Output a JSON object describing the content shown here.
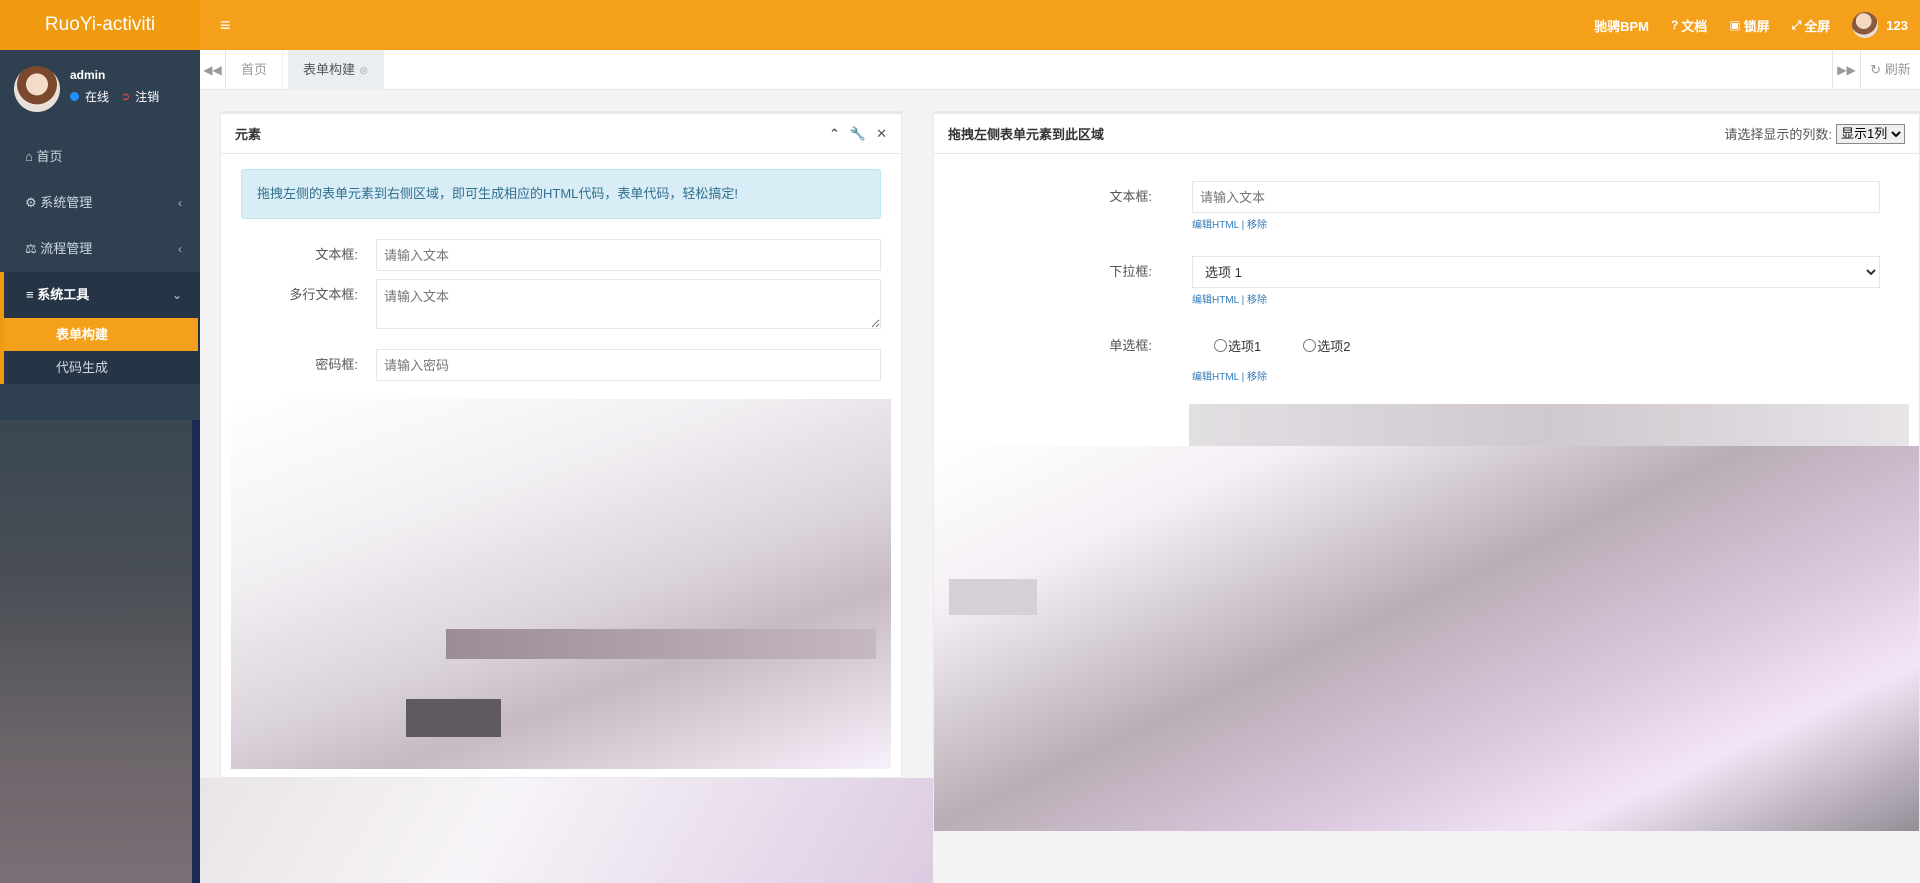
{
  "app": {
    "logo": "RuoYi-activiti",
    "menu_toggle_icon": "≡"
  },
  "topnav": {
    "items": [
      {
        "icon": "",
        "label": "驰骋BPM"
      },
      {
        "icon": "?",
        "label": "文档"
      },
      {
        "icon": "🔒",
        "label": "锁屏"
      },
      {
        "icon": "⤢",
        "label": "全屏"
      }
    ],
    "user": "123"
  },
  "sidebar": {
    "user": {
      "name": "admin",
      "status": "在线",
      "logout": "注销"
    },
    "menu": [
      {
        "icon": "⌂",
        "label": "首页"
      },
      {
        "icon": "⚙",
        "label": "系统管理",
        "chevron": "‹"
      },
      {
        "icon": "⚖",
        "label": "流程管理",
        "chevron": "‹"
      },
      {
        "icon": "≡",
        "label": "系统工具",
        "chevron": "⌄"
      }
    ],
    "submenu": [
      {
        "label": "表单构建"
      },
      {
        "label": "代码生成"
      }
    ]
  },
  "tabs": {
    "items": [
      {
        "label": "首页"
      },
      {
        "label": "表单构建",
        "close": "⊗"
      }
    ],
    "refresh": "刷新"
  },
  "left_panel": {
    "title": "元素",
    "alert": "拖拽左侧的表单元素到右侧区域，即可生成相应的HTML代码，表单代码，轻松搞定!",
    "fields": [
      {
        "label": "文本框:",
        "placeholder": "请输入文本"
      },
      {
        "label": "多行文本框:",
        "placeholder": "请输入文本"
      },
      {
        "label": "密码框:",
        "placeholder": "请输入密码"
      }
    ]
  },
  "right_panel": {
    "title": "拖拽左侧表单元素到此区域",
    "cols_label": "请选择显示的列数:",
    "cols_value": "显示1列",
    "fields": {
      "text": {
        "label": "文本框:",
        "placeholder": "请输入文本"
      },
      "select": {
        "label": "下拉框:",
        "value": "选项 1"
      },
      "radio": {
        "label": "单选框:",
        "options": [
          "选项1",
          "选项2"
        ]
      }
    },
    "links": {
      "edit": "编辑HTML",
      "sep": "|",
      "remove": "移除"
    }
  }
}
